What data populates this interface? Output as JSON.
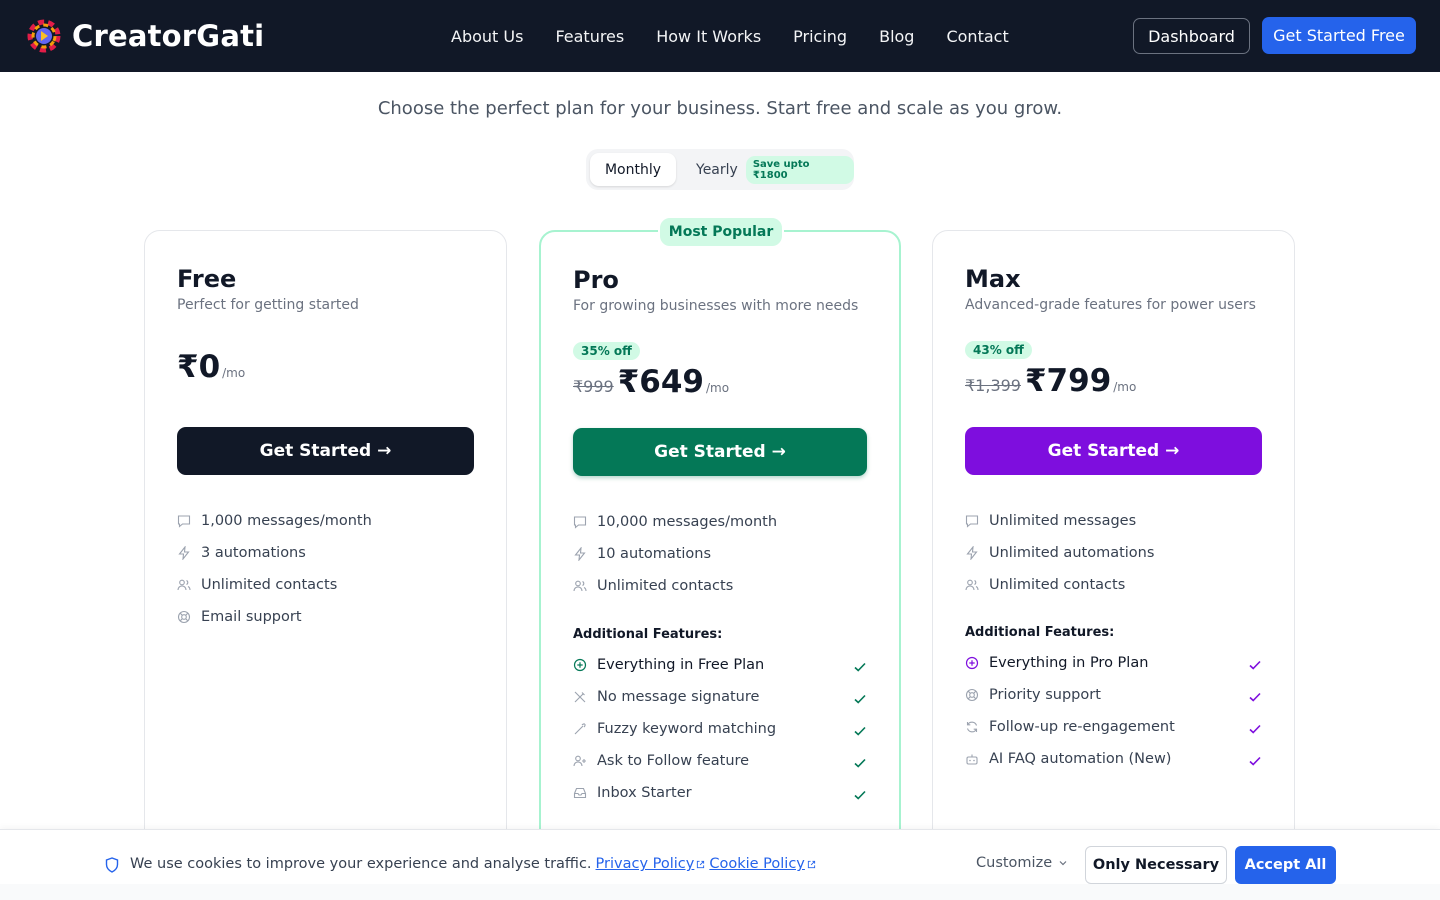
{
  "header": {
    "brand": "CreatorGati",
    "nav": [
      "About Us",
      "Features",
      "How It Works",
      "Pricing",
      "Blog",
      "Contact"
    ],
    "dashboard_label": "Dashboard",
    "get_started_label": "Get Started Free"
  },
  "pricing": {
    "subtitle": "Choose the perfect plan for your business. Start free and scale as you grow.",
    "toggle": {
      "monthly": "Monthly",
      "yearly": "Yearly",
      "save_badge": "Save upto ₹1800",
      "selected": "Monthly"
    }
  },
  "plans": {
    "free": {
      "name": "Free",
      "desc": "Perfect for getting started",
      "price": "₹0",
      "per": "/mo",
      "cta": "Get Started →",
      "features": [
        "1,000 messages/month",
        "3 automations",
        "Unlimited contacts",
        "Email support"
      ],
      "feature_icons": [
        "message-icon",
        "bolt-icon",
        "users-icon",
        "lifebuoy-icon"
      ]
    },
    "pro": {
      "badge": "Most Popular",
      "name": "Pro",
      "desc": "For growing businesses with more needs",
      "discount": "35% off",
      "old_price": "₹999",
      "price": "₹649",
      "per": "/mo",
      "cta": "Get Started →",
      "features": [
        "10,000 messages/month",
        "10 automations",
        "Unlimited contacts"
      ],
      "additional_title": "Additional Features:",
      "additional": [
        "Everything in Free Plan",
        "No message signature",
        "Fuzzy keyword matching",
        "Ask to Follow feature",
        "Inbox Starter"
      ],
      "accent": "#047857"
    },
    "max": {
      "name": "Max",
      "desc": "Advanced-grade features for power users",
      "discount": "43% off",
      "old_price": "₹1,399",
      "price": "₹799",
      "per": "/mo",
      "cta": "Get Started →",
      "features": [
        "Unlimited messages",
        "Unlimited automations",
        "Unlimited contacts"
      ],
      "additional_title": "Additional Features:",
      "additional": [
        "Everything in Pro Plan",
        "Priority support",
        "Follow-up re-engagement",
        "AI FAQ automation (New)"
      ],
      "accent": "#7e0ede"
    }
  },
  "cookie": {
    "text": "We use cookies to improve your experience and analyse traffic.",
    "privacy_link": "Privacy Policy",
    "cookie_link": "Cookie Policy",
    "customize": "Customize",
    "only_necessary": "Only Necessary",
    "accept_all": "Accept All"
  }
}
